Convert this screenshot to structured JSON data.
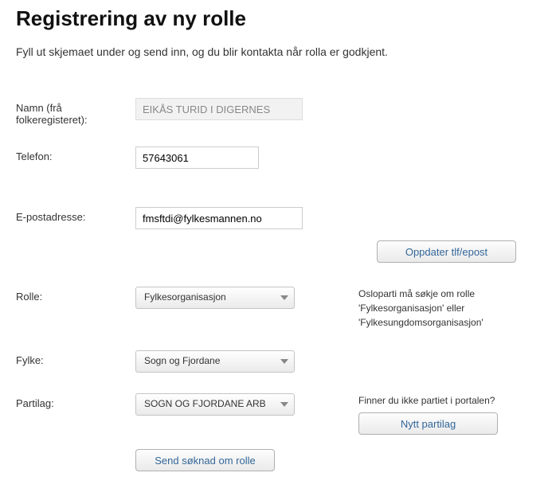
{
  "title": "Registrering av ny rolle",
  "intro": "Fyll ut skjemaet under og send inn, og du blir kontakta når rolla er godkjent.",
  "labels": {
    "name": "Namn (frå folkeregisteret):",
    "phone": "Telefon:",
    "email": "E-postadresse:",
    "role": "Rolle:",
    "county": "Fylke:",
    "party": "Partilag:"
  },
  "values": {
    "name": "EIKÅS TURID I DIGERNES",
    "phone": "57643061",
    "email": "fmsftdi@fylkesmannen.no",
    "role": "Fylkesorganisasjon",
    "county": "Sogn og Fjordane",
    "party": "SOGN OG FJORDANE ARB"
  },
  "buttons": {
    "update": "Oppdater tlf/epost",
    "newParty": "Nytt partilag",
    "send": "Send søknad om rolle"
  },
  "sideText": {
    "roleHint": "Osloparti må søkje om rolle 'Fylkesorganisasjon' eller 'Fylkesungdomsorganisasjon'",
    "partyQuestion": "Finner du ikke partiet i portalen?"
  }
}
